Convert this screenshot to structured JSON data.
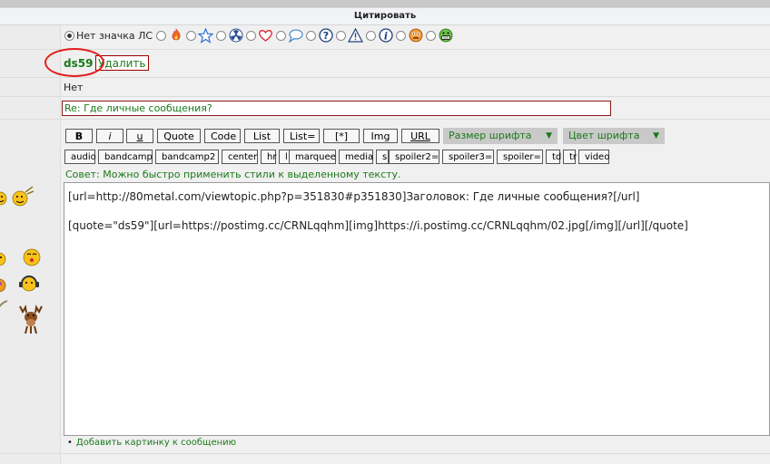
{
  "header": {
    "title": "Цитировать"
  },
  "icons_row": {
    "no_icon_label": "Нет значка ЛС",
    "icons": [
      "flame-icon",
      "star-icon",
      "radiation-icon",
      "heart-icon",
      "speech-bubble-icon",
      "question-icon",
      "warning-icon",
      "info-icon",
      "angry-smiley-icon",
      "grin-smiley-icon"
    ]
  },
  "author": {
    "name": "ds59",
    "delete_label": "Удалить"
  },
  "field_net": {
    "value": "Нет"
  },
  "subject": {
    "value": "Re: Где личные сообщения?"
  },
  "format_buttons": [
    {
      "label": "B"
    },
    {
      "label": "i"
    },
    {
      "label": "u"
    },
    {
      "label": "Quote"
    },
    {
      "label": "Code"
    },
    {
      "label": "List"
    },
    {
      "label": "List="
    },
    {
      "label": "[*]"
    },
    {
      "label": "Img"
    },
    {
      "label": "URL"
    }
  ],
  "selects": {
    "font_size": "Размер шрифта",
    "font_color": "Цвет шрифта"
  },
  "tag_buttons": [
    "audio",
    "bandcamp",
    "bandcamp2",
    "center",
    "hr",
    "l",
    "marquee",
    "media",
    "s",
    "spoiler2=",
    "spoiler3=",
    "spoiler=",
    "td",
    "tr",
    "video"
  ],
  "tip": "Совет: Можно быстро применить стили к выделенному тексту.",
  "editor": {
    "line1": "[url=http://80metal.com/viewtopic.php?p=351830#p351830]Заголовок: Где личные сообщения?[/url]",
    "line2": "[quote=\"ds59\"][url=https://postimg.cc/CRNLqqhm][img]https://i.postimg.cc/CRNLqqhm/02.jpg[/img][/url][/quote]"
  },
  "add_image_link": "Добавить картинку к сообщению",
  "colors": {
    "accent_green": "#1a7a1a",
    "annotation_red": "#e21d1d",
    "border_dark_red": "#8b1a1a"
  }
}
